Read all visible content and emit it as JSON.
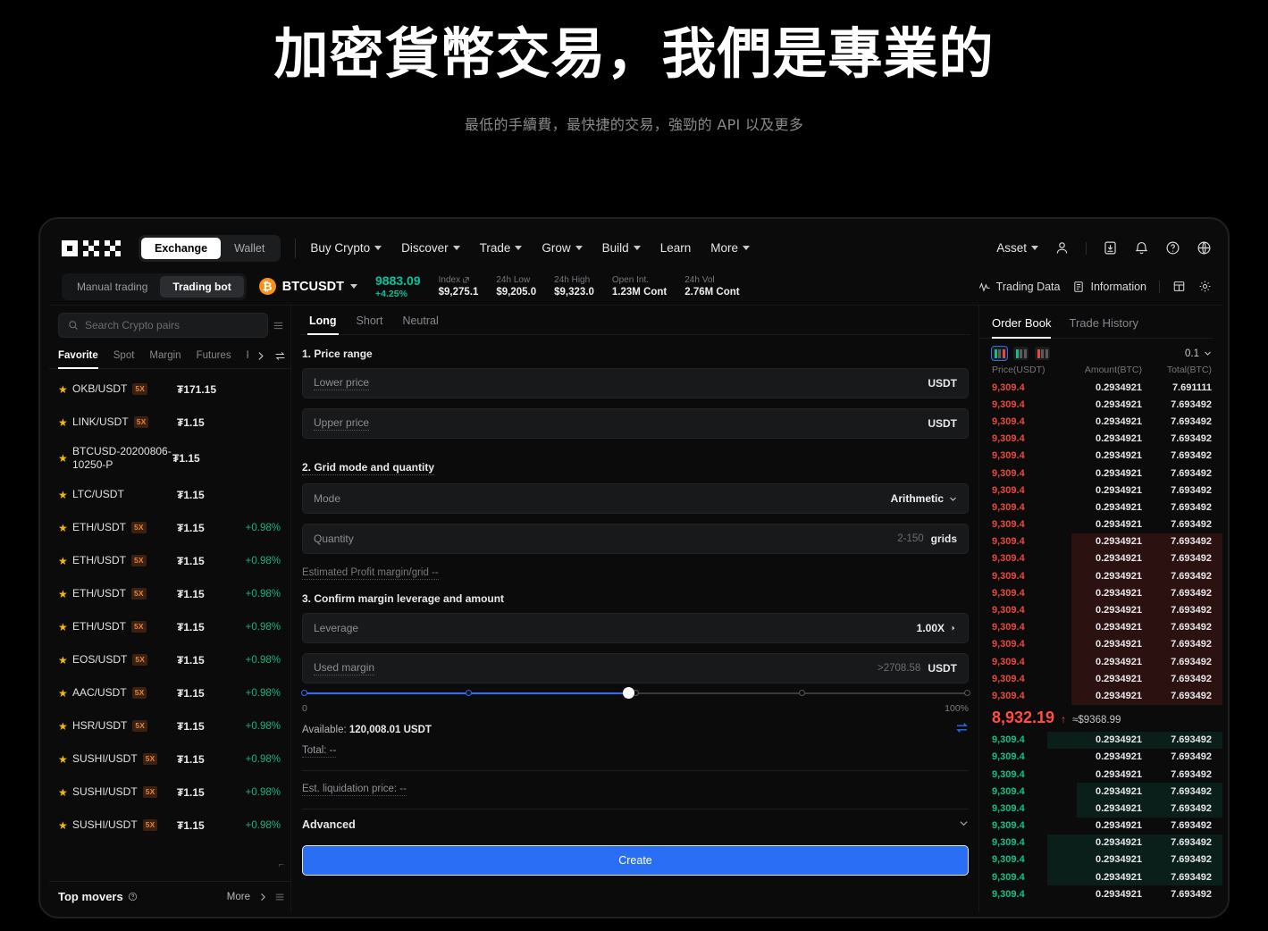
{
  "hero": {
    "title": "加密貨幣交易，我們是專業的",
    "subtitle": "最低的手續費，最快捷的交易，強勁的 API 以及更多"
  },
  "topnav": {
    "logo_alt": "OKX",
    "segments": [
      {
        "label": "Exchange",
        "active": true
      },
      {
        "label": "Wallet",
        "active": false
      }
    ],
    "links": [
      {
        "label": "Buy Crypto",
        "caret": true
      },
      {
        "label": "Discover",
        "caret": true
      },
      {
        "label": "Trade",
        "caret": true
      },
      {
        "label": "Grow",
        "caret": true
      },
      {
        "label": "Build",
        "caret": true
      },
      {
        "label": "Learn",
        "caret": false
      },
      {
        "label": "More",
        "caret": true
      }
    ],
    "asset_label": "Asset",
    "icons": [
      "profile-icon",
      "download-icon",
      "bell-icon",
      "help-icon",
      "globe-icon"
    ]
  },
  "marketbar": {
    "modes": [
      {
        "label": "Manual trading",
        "active": false
      },
      {
        "label": "Trading bot",
        "active": true
      }
    ],
    "coin_symbol": "₿",
    "pair": "BTCUSDT",
    "last_price": "9883.09",
    "change_pct": "+4.25%",
    "stats": [
      {
        "label": "Index",
        "value": "$9,275.1",
        "external": true
      },
      {
        "label": "24h Low",
        "value": "$9,205.0",
        "external": false
      },
      {
        "label": "24h High",
        "value": "$9,323.0",
        "external": false
      },
      {
        "label": "Open Int.",
        "value": "1.23M Cont",
        "external": false
      },
      {
        "label": "24h Vol",
        "value": "2.76M Cont",
        "external": false
      }
    ],
    "right_items": [
      {
        "label": "Trading Data",
        "icon": "pulse-icon"
      },
      {
        "label": "Information",
        "icon": "document-icon"
      }
    ],
    "layout_icon": "layout-icon",
    "settings_icon": "gear-icon"
  },
  "sidebar": {
    "search_placeholder": "Search Crypto pairs",
    "search_value": "",
    "tabs": [
      {
        "label": "Favorite",
        "active": true
      },
      {
        "label": "Spot",
        "active": false
      },
      {
        "label": "Margin",
        "active": false
      },
      {
        "label": "Futures",
        "active": false
      },
      {
        "label": "P",
        "active": false
      }
    ],
    "pairs": [
      {
        "name": "OKB/USDT",
        "leverage": "5X",
        "price": "₮171.15",
        "change": ""
      },
      {
        "name": "LINK/USDT",
        "leverage": "5X",
        "price": "₮1.15",
        "change": ""
      },
      {
        "name": "BTCUSD-20200806-10250-P",
        "leverage": "",
        "price": "₮1.15",
        "change": ""
      },
      {
        "name": "LTC/USDT",
        "leverage": "",
        "price": "₮1.15",
        "change": ""
      },
      {
        "name": "ETH/USDT",
        "leverage": "5X",
        "price": "₮1.15",
        "change": "+0.98%"
      },
      {
        "name": "ETH/USDT",
        "leverage": "5X",
        "price": "₮1.15",
        "change": "+0.98%"
      },
      {
        "name": "ETH/USDT",
        "leverage": "5X",
        "price": "₮1.15",
        "change": "+0.98%"
      },
      {
        "name": "ETH/USDT",
        "leverage": "5X",
        "price": "₮1.15",
        "change": "+0.98%"
      },
      {
        "name": "EOS/USDT",
        "leverage": "5X",
        "price": "₮1.15",
        "change": "+0.98%"
      },
      {
        "name": "AAC/USDT",
        "leverage": "5X",
        "price": "₮1.15",
        "change": "+0.98%"
      },
      {
        "name": "HSR/USDT",
        "leverage": "5X",
        "price": "₮1.15",
        "change": "+0.98%"
      },
      {
        "name": "SUSHI/USDT",
        "leverage": "5X",
        "price": "₮1.15",
        "change": "+0.98%"
      },
      {
        "name": "SUSHI/USDT",
        "leverage": "5X",
        "price": "₮1.15",
        "change": "+0.98%"
      },
      {
        "name": "SUSHI/USDT",
        "leverage": "5X",
        "price": "₮1.15",
        "change": "+0.98%"
      }
    ],
    "top_movers": {
      "label": "Top movers",
      "more": "More"
    }
  },
  "form": {
    "tabs": [
      {
        "label": "Long",
        "active": true
      },
      {
        "label": "Short",
        "active": false
      },
      {
        "label": "Neutral",
        "active": false
      }
    ],
    "section1": "1. Price range",
    "lower_price": {
      "label": "Lower price",
      "value": "",
      "unit": "USDT"
    },
    "upper_price": {
      "label": "Upper price",
      "value": "",
      "unit": "USDT"
    },
    "section2": "2. Grid mode and quantity",
    "mode": {
      "label": "Mode",
      "value": "Arithmetic"
    },
    "quantity": {
      "label": "Quantity",
      "value": "",
      "hint": "2-150",
      "unit": "grids"
    },
    "est_profit": "Estimated Profit margin/grid --",
    "section3": "3. Confirm margin leverage and amount",
    "leverage": {
      "label": "Leverage",
      "value": "1.00X"
    },
    "used_margin": {
      "label": "Used margin",
      "value": "",
      "hint": ">2708.58",
      "unit": "USDT"
    },
    "slider": {
      "min_label": "0",
      "max_label": "100%",
      "value": 49
    },
    "available": {
      "label": "Available:",
      "value": "120,008.01 USDT"
    },
    "total": "Total: --",
    "liquidation": "Est. liquidation price: --",
    "advanced": "Advanced",
    "create": "Create"
  },
  "orderbook": {
    "tabs": [
      {
        "label": "Order Book",
        "active": true
      },
      {
        "label": "Trade History",
        "active": false
      }
    ],
    "grouping": "0.1",
    "headers": [
      "Price(USDT)",
      "Amount(BTC)",
      "Total(BTC)"
    ],
    "asks": [
      {
        "price": "9,309.4",
        "amount": "0.2934921",
        "total": "7.691111",
        "depth": 0
      },
      {
        "price": "9,309.4",
        "amount": "0.2934921",
        "total": "7.693492",
        "depth": 0
      },
      {
        "price": "9,309.4",
        "amount": "0.2934921",
        "total": "7.693492",
        "depth": 0
      },
      {
        "price": "9,309.4",
        "amount": "0.2934921",
        "total": "7.693492",
        "depth": 0
      },
      {
        "price": "9,309.4",
        "amount": "0.2934921",
        "total": "7.693492",
        "depth": 0
      },
      {
        "price": "9,309.4",
        "amount": "0.2934921",
        "total": "7.693492",
        "depth": 0
      },
      {
        "price": "9,309.4",
        "amount": "0.2934921",
        "total": "7.693492",
        "depth": 0
      },
      {
        "price": "9,309.4",
        "amount": "0.2934921",
        "total": "7.693492",
        "depth": 0
      },
      {
        "price": "9,309.4",
        "amount": "0.2934921",
        "total": "7.693492",
        "depth": 0
      },
      {
        "price": "9,309.4",
        "amount": "0.2934921",
        "total": "7.693492",
        "depth": 62
      },
      {
        "price": "9,309.4",
        "amount": "0.2934921",
        "total": "7.693492",
        "depth": 62
      },
      {
        "price": "9,309.4",
        "amount": "0.2934921",
        "total": "7.693492",
        "depth": 62
      },
      {
        "price": "9,309.4",
        "amount": "0.2934921",
        "total": "7.693492",
        "depth": 62
      },
      {
        "price": "9,309.4",
        "amount": "0.2934921",
        "total": "7.693492",
        "depth": 62
      },
      {
        "price": "9,309.4",
        "amount": "0.2934921",
        "total": "7.693492",
        "depth": 62
      },
      {
        "price": "9,309.4",
        "amount": "0.2934921",
        "total": "7.693492",
        "depth": 62
      },
      {
        "price": "9,309.4",
        "amount": "0.2934921",
        "total": "7.693492",
        "depth": 62
      },
      {
        "price": "9,309.4",
        "amount": "0.2934921",
        "total": "7.693492",
        "depth": 62
      },
      {
        "price": "9,309.4",
        "amount": "0.2934921",
        "total": "7.693492",
        "depth": 62
      }
    ],
    "mid": {
      "price": "8,932.19",
      "direction": "↑",
      "approx": "≈$9368.99"
    },
    "bids": [
      {
        "price": "9,309.4",
        "amount": "0.2934921",
        "total": "7.693492",
        "depth": 72
      },
      {
        "price": "9,309.4",
        "amount": "0.2934921",
        "total": "7.693492",
        "depth": 0
      },
      {
        "price": "9,309.4",
        "amount": "0.2934921",
        "total": "7.693492",
        "depth": 0
      },
      {
        "price": "9,309.4",
        "amount": "0.2934921",
        "total": "7.693492",
        "depth": 60
      },
      {
        "price": "9,309.4",
        "amount": "0.2934921",
        "total": "7.693492",
        "depth": 60
      },
      {
        "price": "9,309.4",
        "amount": "0.2934921",
        "total": "7.693492",
        "depth": 0
      },
      {
        "price": "9,309.4",
        "amount": "0.2934921",
        "total": "7.693492",
        "depth": 72
      },
      {
        "price": "9,309.4",
        "amount": "0.2934921",
        "total": "7.693492",
        "depth": 72
      },
      {
        "price": "9,309.4",
        "amount": "0.2934921",
        "total": "7.693492",
        "depth": 72
      },
      {
        "price": "9,309.4",
        "amount": "0.2934921",
        "total": "7.693492",
        "depth": 0
      }
    ]
  },
  "colors": {
    "accent_blue": "#2b6ef6",
    "up_green": "#0ec08a",
    "down_red": "#e8483d",
    "brand_orange": "#f7931a",
    "star_yellow": "#f0b90b"
  }
}
